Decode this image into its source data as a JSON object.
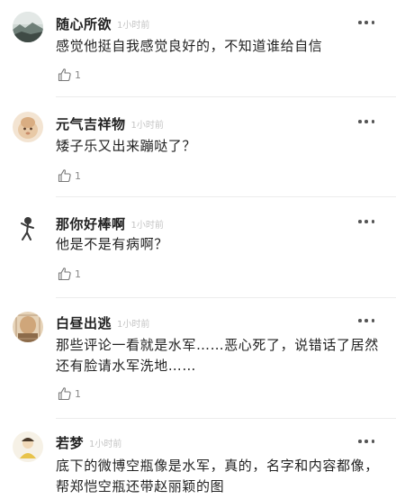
{
  "comments": [
    {
      "user": "随心所欲",
      "time": "1小时前",
      "text": "感觉他挺自我感觉良好的，不知道谁给自信",
      "likes": "1"
    },
    {
      "user": "元气吉祥物",
      "time": "1小时前",
      "text": "矮子乐又出来蹦哒了？",
      "likes": "1"
    },
    {
      "user": "那你好棒啊",
      "time": "1小时前",
      "text": "他是不是有病啊？",
      "likes": "1"
    },
    {
      "user": "白昼出逃",
      "time": "1小时前",
      "text": "那些评论一看就是水军……恶心死了，说错话了居然还有脸请水军洗地……",
      "likes": "1"
    },
    {
      "user": "若梦",
      "time": "1小时前",
      "text": "底下的微博空瓶像是水军，真的，名字和内容都像，帮郑恺空瓶还带赵丽颖的图",
      "likes": ""
    }
  ],
  "icons": {
    "like": "thumbs-up-icon",
    "more": "more-dots-icon"
  }
}
